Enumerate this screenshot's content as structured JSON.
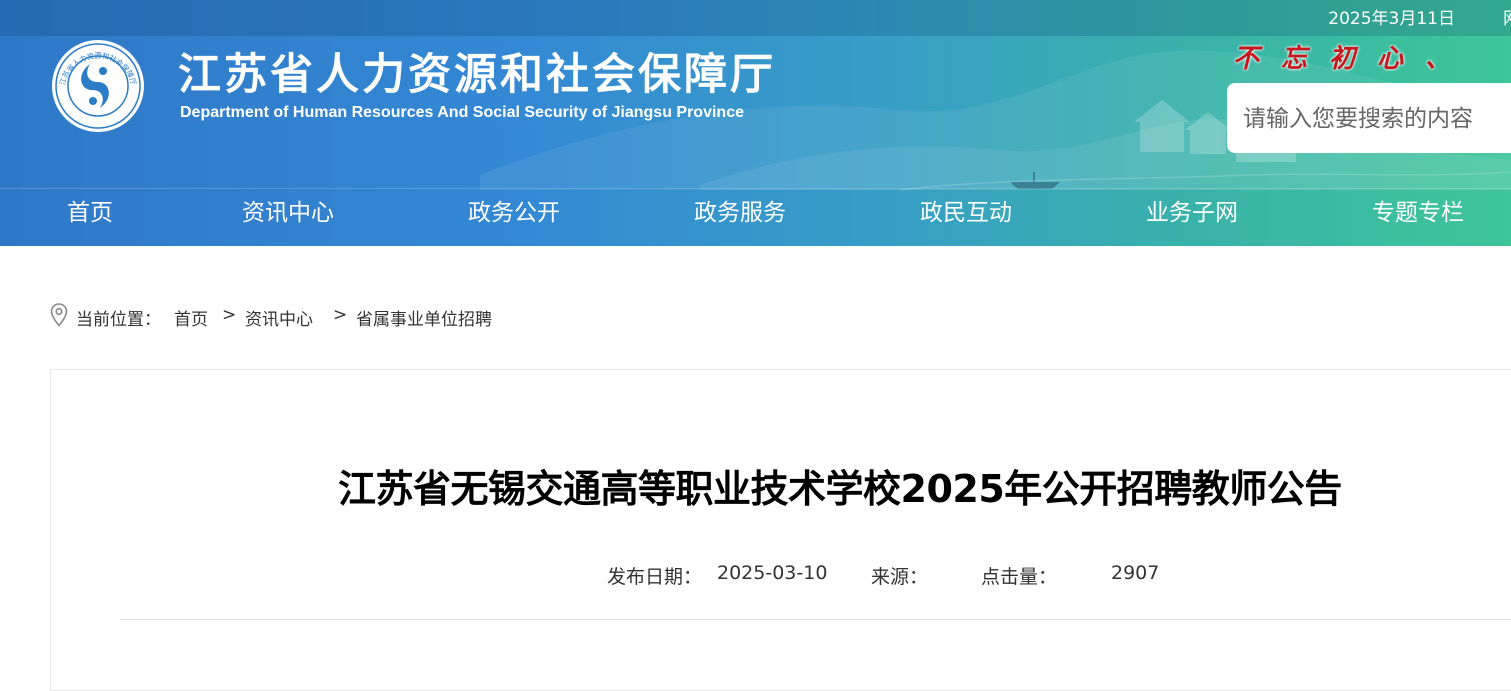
{
  "header": {
    "date": "2025年3月11日",
    "topbar_extra": "网",
    "title": "江苏省人力资源和社会保障厅",
    "subtitle": "Department of Human Resources And Social Security of Jiangsu Province",
    "logo_text": "江苏省人力资源和社会保障厅",
    "slogan": "不忘初心、",
    "search": {
      "placeholder": "请输入您要搜索的内容"
    }
  },
  "nav": {
    "items": [
      {
        "label": "首页"
      },
      {
        "label": "资讯中心"
      },
      {
        "label": "政务公开"
      },
      {
        "label": "政务服务"
      },
      {
        "label": "政民互动"
      },
      {
        "label": "业务子网"
      },
      {
        "label": "专题专栏"
      }
    ]
  },
  "breadcrumb": {
    "prefix": "当前位置：",
    "items": [
      "首页",
      "资讯中心",
      "省属事业单位招聘"
    ],
    "separator": ">"
  },
  "article": {
    "title": "江苏省无锡交通高等职业技术学校2025年公开招聘教师公告",
    "publish_date_label": "发布日期：",
    "publish_date": "2025-03-10",
    "source_label": "来源：",
    "source": "",
    "clicks_label": "点击量：",
    "clicks": "2907"
  },
  "colors": {
    "header_start": "#2f78c8",
    "header_end": "#3ec59a",
    "slogan": "#c8161d",
    "text": "#333333"
  }
}
